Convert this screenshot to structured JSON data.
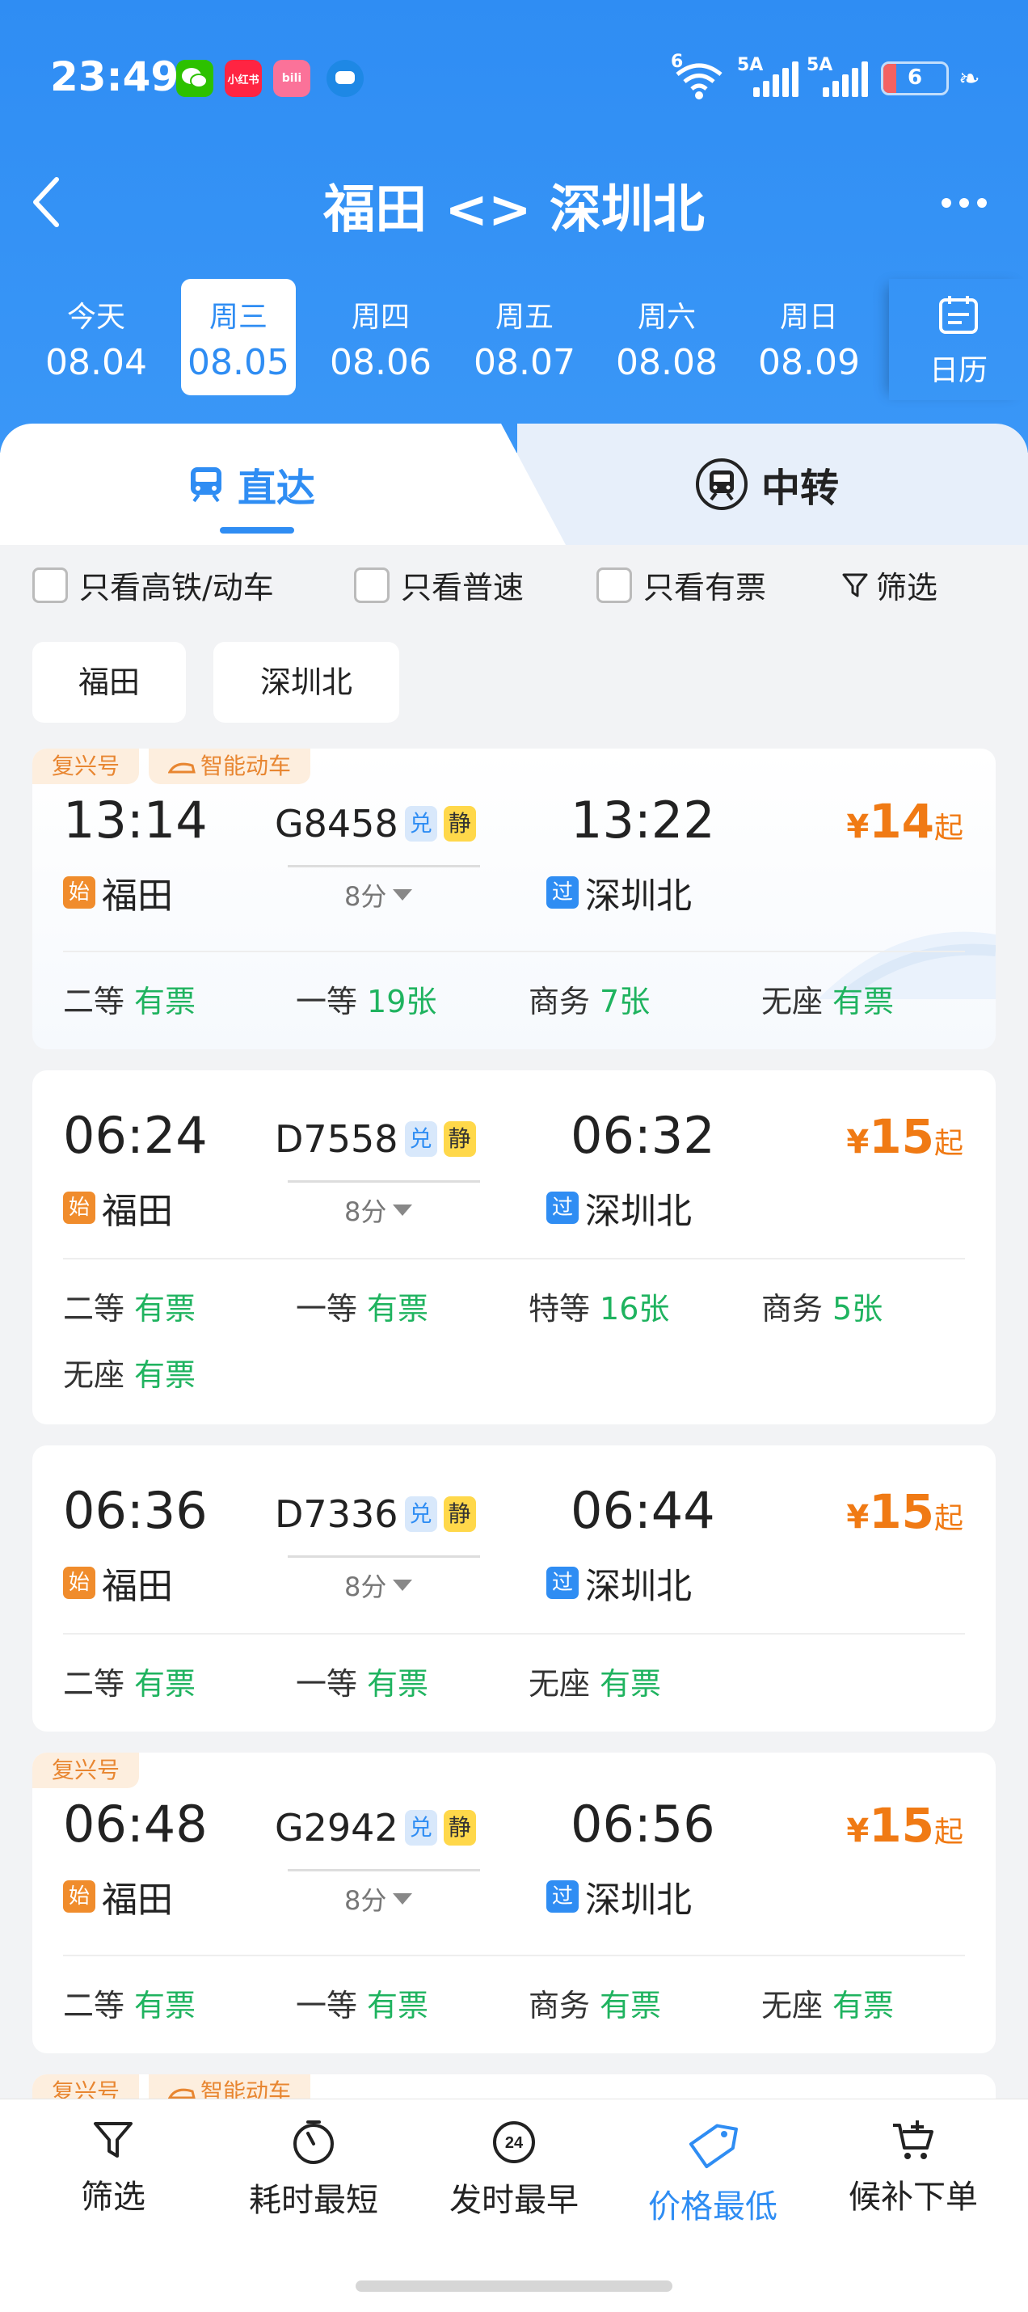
{
  "status_bar": {
    "time": "23:49",
    "apps": [
      {
        "name": "wechat-icon",
        "label": "",
        "color": "#2dc100"
      },
      {
        "name": "xiaohongshu-icon",
        "label": "小红书",
        "color": "#ff2442"
      },
      {
        "name": "bilibili-icon",
        "label": "bili",
        "color": "#fb7299"
      },
      {
        "name": "message-icon",
        "label": "",
        "color": "#1e88e5"
      }
    ],
    "wifi_label": "6",
    "sim1_label": "5A",
    "sim2_label": "5A",
    "battery_level": "6"
  },
  "header": {
    "back_icon": "chevron-left-icon",
    "title": "福田 <> 深圳北",
    "more_icon": "more-icon"
  },
  "dates": [
    {
      "weekday": "今天",
      "date": "08.04",
      "selected": false
    },
    {
      "weekday": "周三",
      "date": "08.05",
      "selected": true
    },
    {
      "weekday": "周四",
      "date": "08.06",
      "selected": false
    },
    {
      "weekday": "周五",
      "date": "08.07",
      "selected": false
    },
    {
      "weekday": "周六",
      "date": "08.08",
      "selected": false
    },
    {
      "weekday": "周日",
      "date": "08.09",
      "selected": false
    }
  ],
  "calendar_label": "日历",
  "tabs": {
    "direct": "直达",
    "transfer": "中转"
  },
  "filters": {
    "high_speed": "只看高铁/动车",
    "normal": "只看普速",
    "available": "只看有票",
    "filter": "筛选"
  },
  "station_chips": {
    "from": "福田",
    "to": "深圳北"
  },
  "trains": [
    {
      "tags": [
        "复兴号",
        "智能动车"
      ],
      "dep_time": "13:14",
      "train_no": "G8458",
      "arr_time": "13:22",
      "duration": "8分",
      "from": "福田",
      "to": "深圳北",
      "start_badge": "始",
      "pass_badge": "过",
      "price_cur": "¥",
      "price": "14",
      "price_suffix": "起",
      "seats": [
        {
          "type": "二等",
          "value": "有票"
        },
        {
          "type": "一等",
          "value": "19张"
        },
        {
          "type": "商务",
          "value": "7张"
        },
        {
          "type": "无座",
          "value": "有票"
        }
      ]
    },
    {
      "tags": [],
      "dep_time": "06:24",
      "train_no": "D7558",
      "arr_time": "06:32",
      "duration": "8分",
      "from": "福田",
      "to": "深圳北",
      "start_badge": "始",
      "pass_badge": "过",
      "price_cur": "¥",
      "price": "15",
      "price_suffix": "起",
      "seats": [
        {
          "type": "二等",
          "value": "有票"
        },
        {
          "type": "一等",
          "value": "有票"
        },
        {
          "type": "特等",
          "value": "16张"
        },
        {
          "type": "商务",
          "value": "5张"
        },
        {
          "type": "无座",
          "value": "有票"
        }
      ]
    },
    {
      "tags": [],
      "dep_time": "06:36",
      "train_no": "D7336",
      "arr_time": "06:44",
      "duration": "8分",
      "from": "福田",
      "to": "深圳北",
      "start_badge": "始",
      "pass_badge": "过",
      "price_cur": "¥",
      "price": "15",
      "price_suffix": "起",
      "seats": [
        {
          "type": "二等",
          "value": "有票"
        },
        {
          "type": "一等",
          "value": "有票"
        },
        {
          "type": "无座",
          "value": "有票"
        }
      ]
    },
    {
      "tags": [
        "复兴号"
      ],
      "dep_time": "06:48",
      "train_no": "G2942",
      "arr_time": "06:56",
      "duration": "8分",
      "from": "福田",
      "to": "深圳北",
      "start_badge": "始",
      "pass_badge": "过",
      "price_cur": "¥",
      "price": "15",
      "price_suffix": "起",
      "seats": [
        {
          "type": "二等",
          "value": "有票"
        },
        {
          "type": "一等",
          "value": "有票"
        },
        {
          "type": "商务",
          "value": "有票"
        },
        {
          "type": "无座",
          "value": "有票"
        }
      ]
    }
  ],
  "badges": {
    "dui": "兑",
    "jing": "静"
  },
  "next_card_tags": [
    "复兴号",
    "智能动车"
  ],
  "bottom_bar": {
    "filter": "筛选",
    "shortest": "耗时最短",
    "earliest": "发时最早",
    "cheapest": "价格最低",
    "waitlist": "候补下单",
    "earliest_icon_text": "24"
  },
  "colors": {
    "primary": "#2f8df3",
    "price": "#f07a14",
    "available": "#1fb35f",
    "tag": "#e88631"
  }
}
